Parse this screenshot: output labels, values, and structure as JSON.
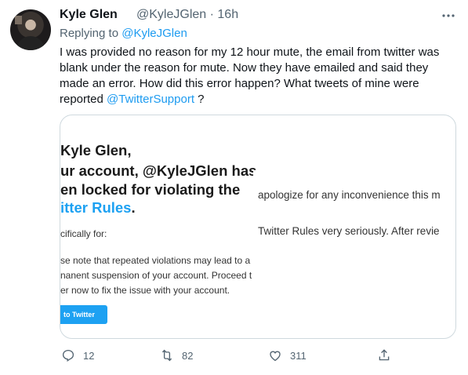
{
  "tweet": {
    "author_name": "Kyle Glen",
    "author_handle": "@KyleJGlen",
    "separator": "·",
    "time": "16h",
    "replying_prefix": "Replying to",
    "replying_handle": "@KyleJGlen",
    "body": "I was provided no reason for my 12 hour mute, the email from twitter was blank under the reason for mute. Now they have emailed and said they made an error. How did this error happen? What tweets of mine were reported",
    "body_mention": "@TwitterSupport",
    "body_suffix": " ?"
  },
  "media": {
    "left": {
      "line1": "Kyle Glen,",
      "line2": "ur account, @KyleJGlen has",
      "line3": "en locked for violating the",
      "line4_blue": "itter Rules",
      "line4_end": ".",
      "specific": "cifically for:",
      "note1": "se note that repeated violations may lead to a",
      "note2": "nanent suspension of your account. Proceed t",
      "note3": "er now to fix the issue with your account.",
      "button": "to Twitter"
    },
    "right": {
      "line1": "apologize for any inconvenience this m",
      "line2": "Twitter Rules very seriously. After revie"
    }
  },
  "actions": {
    "replies": "12",
    "retweets": "82",
    "likes": "311"
  },
  "icons": [
    "more-icon",
    "reply-icon",
    "retweet-icon",
    "like-icon",
    "share-icon"
  ],
  "colors": {
    "accent": "#1d9bf0",
    "muted": "#536471"
  }
}
